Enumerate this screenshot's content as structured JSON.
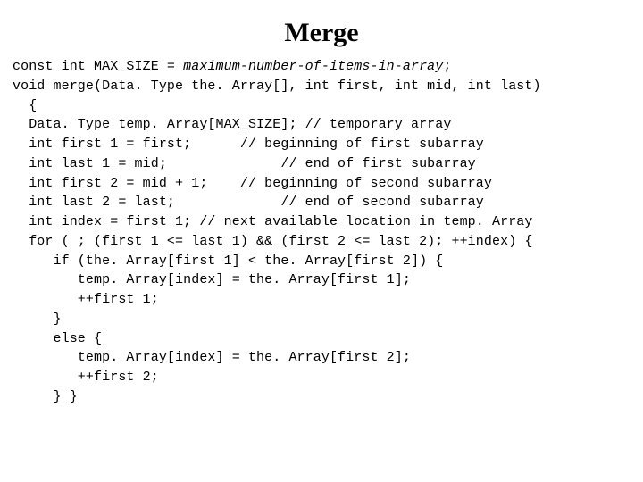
{
  "title": "Merge",
  "code": {
    "l1a": "const int MAX_SIZE = ",
    "l1b": "maximum-number-of-items-in-array",
    "l1c": ";",
    "l2": "void merge(Data. Type the. Array[], int first, int mid, int last)",
    "l3": "  {",
    "l4": "  Data. Type temp. Array[MAX_SIZE]; // temporary array",
    "l5": "  int first 1 = first;      // beginning of first subarray",
    "l6": "  int last 1 = mid;              // end of first subarray",
    "l7": "  int first 2 = mid + 1;    // beginning of second subarray",
    "l8": "  int last 2 = last;             // end of second subarray",
    "l9": "  int index = first 1; // next available location in temp. Array",
    "l10": "  for ( ; (first 1 <= last 1) && (first 2 <= last 2); ++index) {",
    "l11": "     if (the. Array[first 1] < the. Array[first 2]) {",
    "l12": "        temp. Array[index] = the. Array[first 1];",
    "l13": "        ++first 1;",
    "l14": "     }",
    "l15": "     else {",
    "l16": "        temp. Array[index] = the. Array[first 2];",
    "l17": "        ++first 2;",
    "l18": "     } }"
  }
}
